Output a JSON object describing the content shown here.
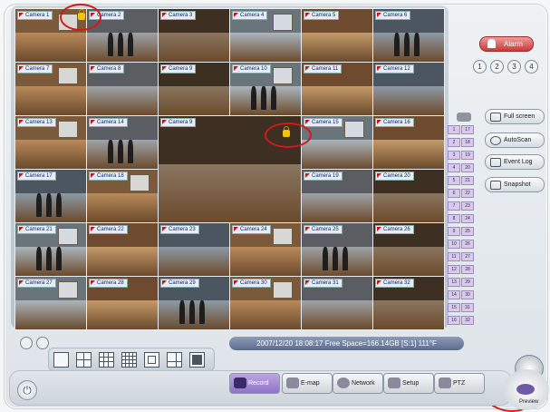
{
  "cameras": [
    {
      "label": "Camera 1"
    },
    {
      "label": "Camera 2"
    },
    {
      "label": "Camera 3"
    },
    {
      "label": "Camera 4"
    },
    {
      "label": "Camera 5"
    },
    {
      "label": "Camera 6"
    },
    {
      "label": "Camera 7"
    },
    {
      "label": "Camera 8"
    },
    {
      "label": "Camera 9"
    },
    {
      "label": "Camera 10"
    },
    {
      "label": "Camera 11"
    },
    {
      "label": "Camera 12"
    },
    {
      "label": "Camera 13"
    },
    {
      "label": "Camera 14"
    },
    {
      "label": "Camera 15"
    },
    {
      "label": "Camera 16"
    },
    {
      "label": "Camera 17"
    },
    {
      "label": "Camera 18"
    },
    {
      "label": "Camera 19"
    },
    {
      "label": "Camera 20"
    },
    {
      "label": "Camera 21"
    },
    {
      "label": "Camera 22"
    },
    {
      "label": "Camera 23"
    },
    {
      "label": "Camera 24"
    },
    {
      "label": "Camera 25"
    },
    {
      "label": "Camera 26"
    },
    {
      "label": "Camera 27"
    },
    {
      "label": "Camera 28"
    },
    {
      "label": "Camera 29"
    },
    {
      "label": "Camera 30"
    },
    {
      "label": "Camera 31"
    },
    {
      "label": "Camera 32"
    }
  ],
  "status_bar": {
    "text": "2007/12/20 18:08:17  Free Space=166.14GB [S:1] 111°F"
  },
  "side": {
    "alarm": "Alarm",
    "pages": [
      "1",
      "2",
      "3",
      "4"
    ],
    "buttons": [
      {
        "label": "Full screen",
        "icon": "fullscreen-icon"
      },
      {
        "label": "AutoScan",
        "icon": "autoscan-icon"
      },
      {
        "label": "Event Log",
        "icon": "event-log-icon"
      },
      {
        "label": "Snapshot",
        "icon": "snapshot-icon"
      }
    ],
    "channels_left": [
      "1",
      "2",
      "3",
      "4",
      "5",
      "6",
      "7",
      "8",
      "9",
      "10",
      "11",
      "12",
      "13",
      "14",
      "15",
      "16"
    ],
    "channels_right": [
      "17",
      "18",
      "19",
      "20",
      "21",
      "22",
      "23",
      "24",
      "25",
      "26",
      "27",
      "28",
      "29",
      "30",
      "31",
      "32"
    ]
  },
  "toolbar": {
    "record": "Record",
    "emap": "E-map",
    "network": "Network",
    "setup": "Setup",
    "ptz": "PTZ",
    "preview": "Preview"
  },
  "layout_modes": [
    "1",
    "4",
    "9",
    "16",
    "13",
    "6",
    "32"
  ]
}
